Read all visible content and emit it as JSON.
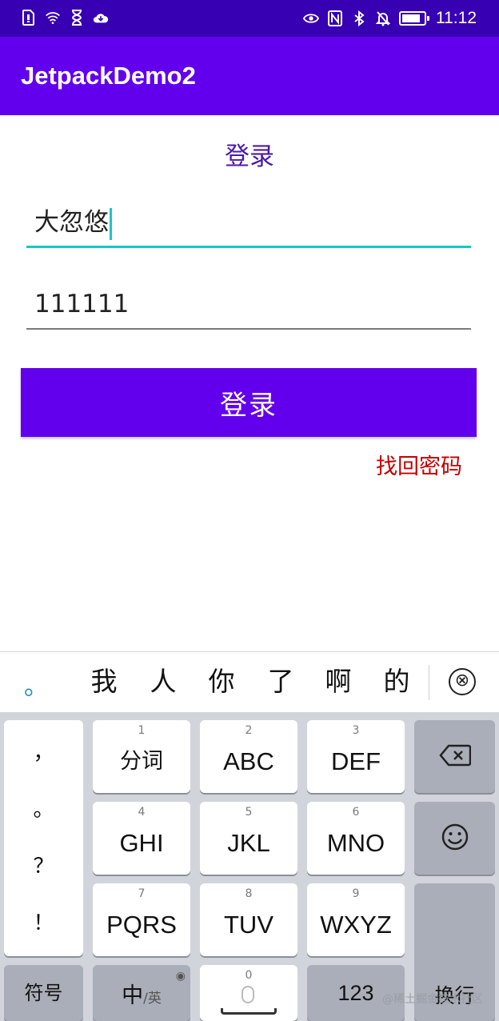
{
  "status_bar": {
    "time": "11:12",
    "battery_level": 0.85,
    "left_icons": [
      "sim-card-icon",
      "wifi-icon",
      "hourglass-icon",
      "cloud-icon"
    ],
    "right_icons": [
      "eye-icon",
      "nfc-icon",
      "bluetooth-icon",
      "bell-off-icon",
      "battery-icon"
    ]
  },
  "app_bar": {
    "title": "JetpackDemo2"
  },
  "main": {
    "title": "登录",
    "username_value": "大忽悠",
    "password_value": "111111",
    "login_button": "登录",
    "forgot_password": "找回密码"
  },
  "candidates": {
    "prefix": "。",
    "items": [
      "我",
      "人",
      "你",
      "了",
      "啊",
      "的"
    ],
    "close_icon": "⊗"
  },
  "keyboard": {
    "punctuation": [
      "，",
      "。",
      "？",
      "！"
    ],
    "rows": [
      [
        {
          "num": "1",
          "label": "分词"
        },
        {
          "num": "2",
          "label": "ABC"
        },
        {
          "num": "3",
          "label": "DEF"
        }
      ],
      [
        {
          "num": "4",
          "label": "GHI"
        },
        {
          "num": "5",
          "label": "JKL"
        },
        {
          "num": "6",
          "label": "MNO"
        }
      ],
      [
        {
          "num": "7",
          "label": "PQRS"
        },
        {
          "num": "8",
          "label": "TUV"
        },
        {
          "num": "9",
          "label": "WXYZ"
        }
      ]
    ],
    "symbols": "符号",
    "lang_main": "中",
    "lang_sub": "/英",
    "space_num": "0",
    "numbers": "123",
    "enter": "换行"
  },
  "watermark": "@稀土掘金技术社区"
}
